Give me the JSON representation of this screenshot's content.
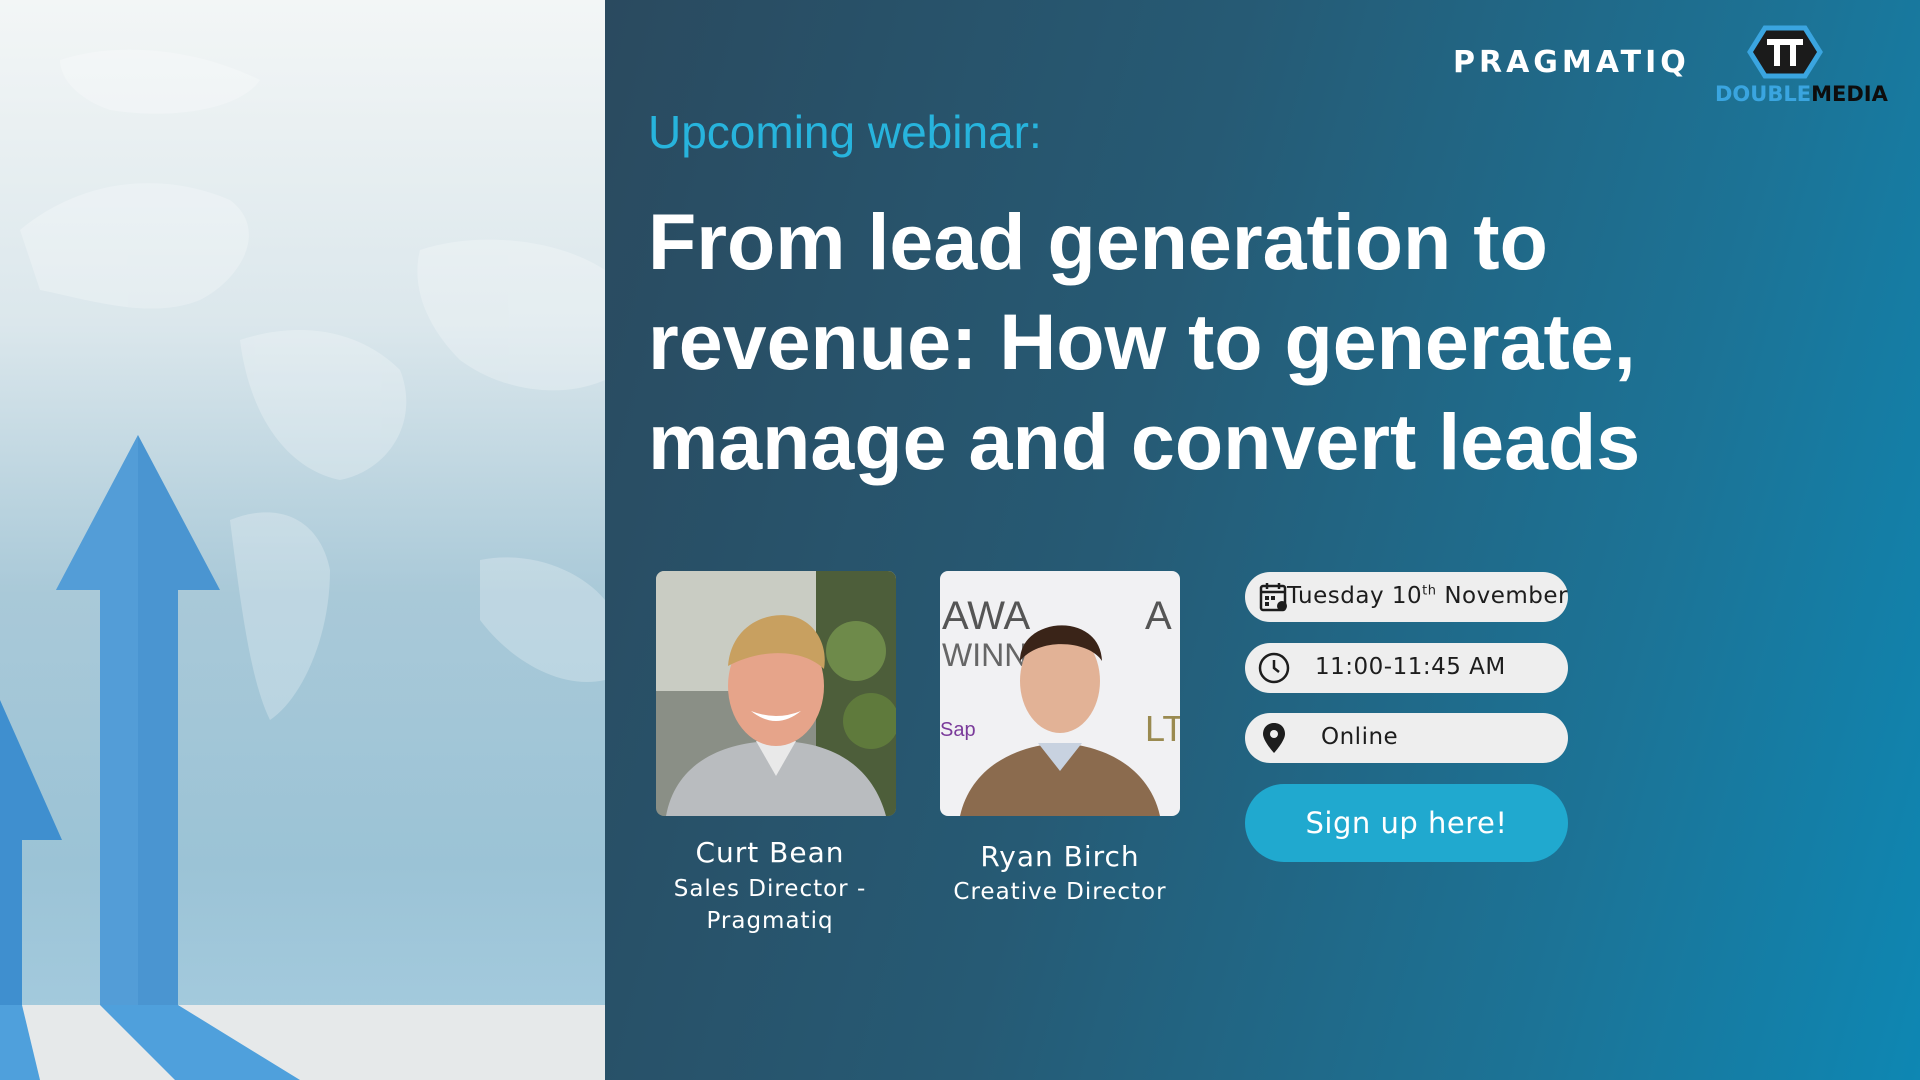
{
  "brand": {
    "pragmatiq": "PRAGMATIQ",
    "double_media_part1": "DOUBLE",
    "double_media_part2": "MEDIA"
  },
  "eyebrow": "Upcoming webinar:",
  "headline": "From lead generation to revenue: How to generate, manage and convert leads",
  "speakers": [
    {
      "name": "Curt Bean",
      "role_line1": "Sales Director -",
      "role_line2": "Pragmatiq"
    },
    {
      "name": "Ryan Birch",
      "role_line1": "Creative Director"
    }
  ],
  "event": {
    "date_day": "Tuesday 10",
    "date_suffix": "th",
    "date_month": "November",
    "time": "11:00-11:45 AM",
    "location": "Online"
  },
  "cta_label": "Sign up here!",
  "icons": [
    "calendar-icon",
    "clock-icon",
    "location-pin-icon",
    "up-arrow-graphic"
  ],
  "colors": {
    "accent": "#27b4dd",
    "cta": "#20a9cf",
    "pill": "#eeeeee"
  }
}
